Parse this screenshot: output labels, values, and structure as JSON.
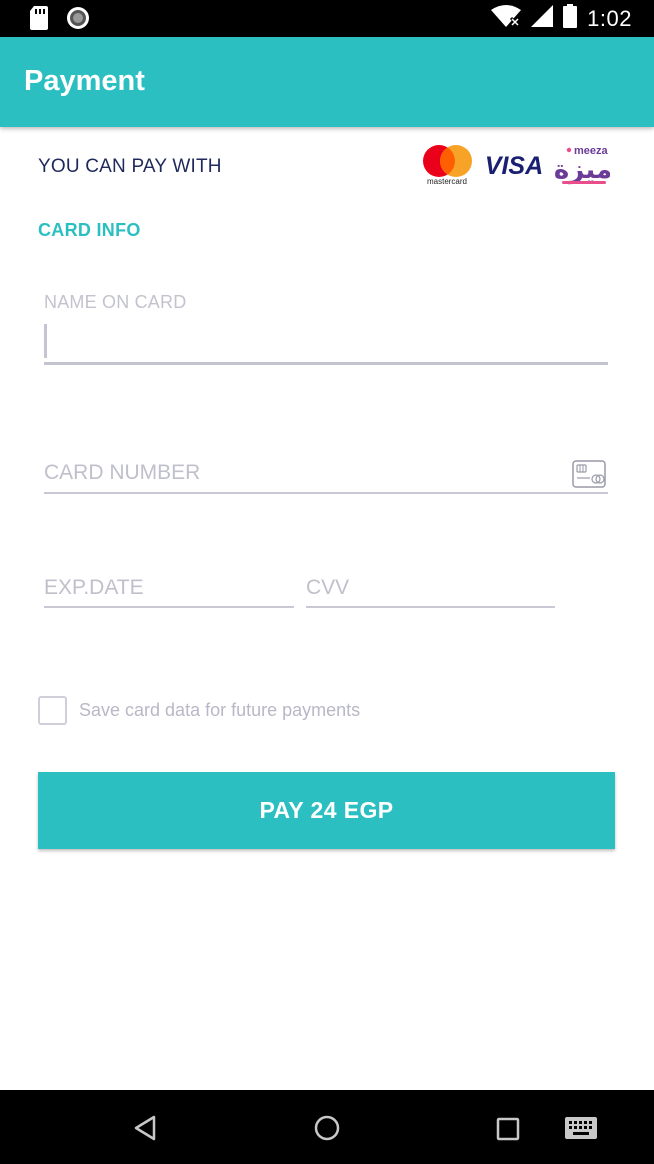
{
  "status_bar": {
    "time": "1:02",
    "icons": [
      "sd-card-icon",
      "sync-icon",
      "wifi-icon",
      "signal-icon",
      "battery-icon"
    ]
  },
  "app_bar": {
    "title": "Payment",
    "color": "#2bbfc2"
  },
  "payment_methods": {
    "label": "YOU CAN PAY WITH",
    "logos": {
      "mastercard_text": "mastercard",
      "visa_text": "VISA",
      "meeza_text": "meeza",
      "meeza_arabic": "ميزة"
    }
  },
  "card_info": {
    "section_title": "CARD INFO",
    "name_on_card": {
      "label": "NAME ON CARD",
      "value": ""
    },
    "card_number": {
      "placeholder": "CARD NUMBER",
      "value": ""
    },
    "exp_date": {
      "placeholder": "EXP.DATE",
      "value": ""
    },
    "cvv": {
      "placeholder": "CVV",
      "value": ""
    }
  },
  "save_card": {
    "label": "Save card data for future payments",
    "checked": false
  },
  "pay_button": {
    "label": "PAY 24 EGP"
  },
  "nav_bar": {
    "icons": [
      "back-icon",
      "home-icon",
      "recents-icon",
      "keyboard-icon"
    ]
  }
}
